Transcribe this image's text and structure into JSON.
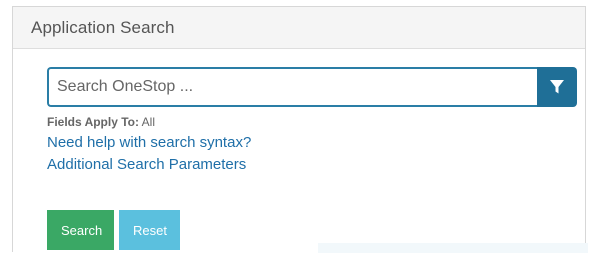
{
  "panel": {
    "title": "Application Search"
  },
  "search": {
    "placeholder": "Search OneStop ...",
    "value": "",
    "filter_icon": "filter-icon",
    "accent_color": "#1f6f97"
  },
  "fields_apply": {
    "label": "Fields Apply To:",
    "value": "All"
  },
  "links": {
    "help_syntax": "Need help with search syntax?",
    "additional_params": "Additional Search Parameters"
  },
  "buttons": {
    "search_label": "Search",
    "search_color": "#3aa865",
    "reset_label": "Reset",
    "reset_color": "#5bc0de"
  }
}
